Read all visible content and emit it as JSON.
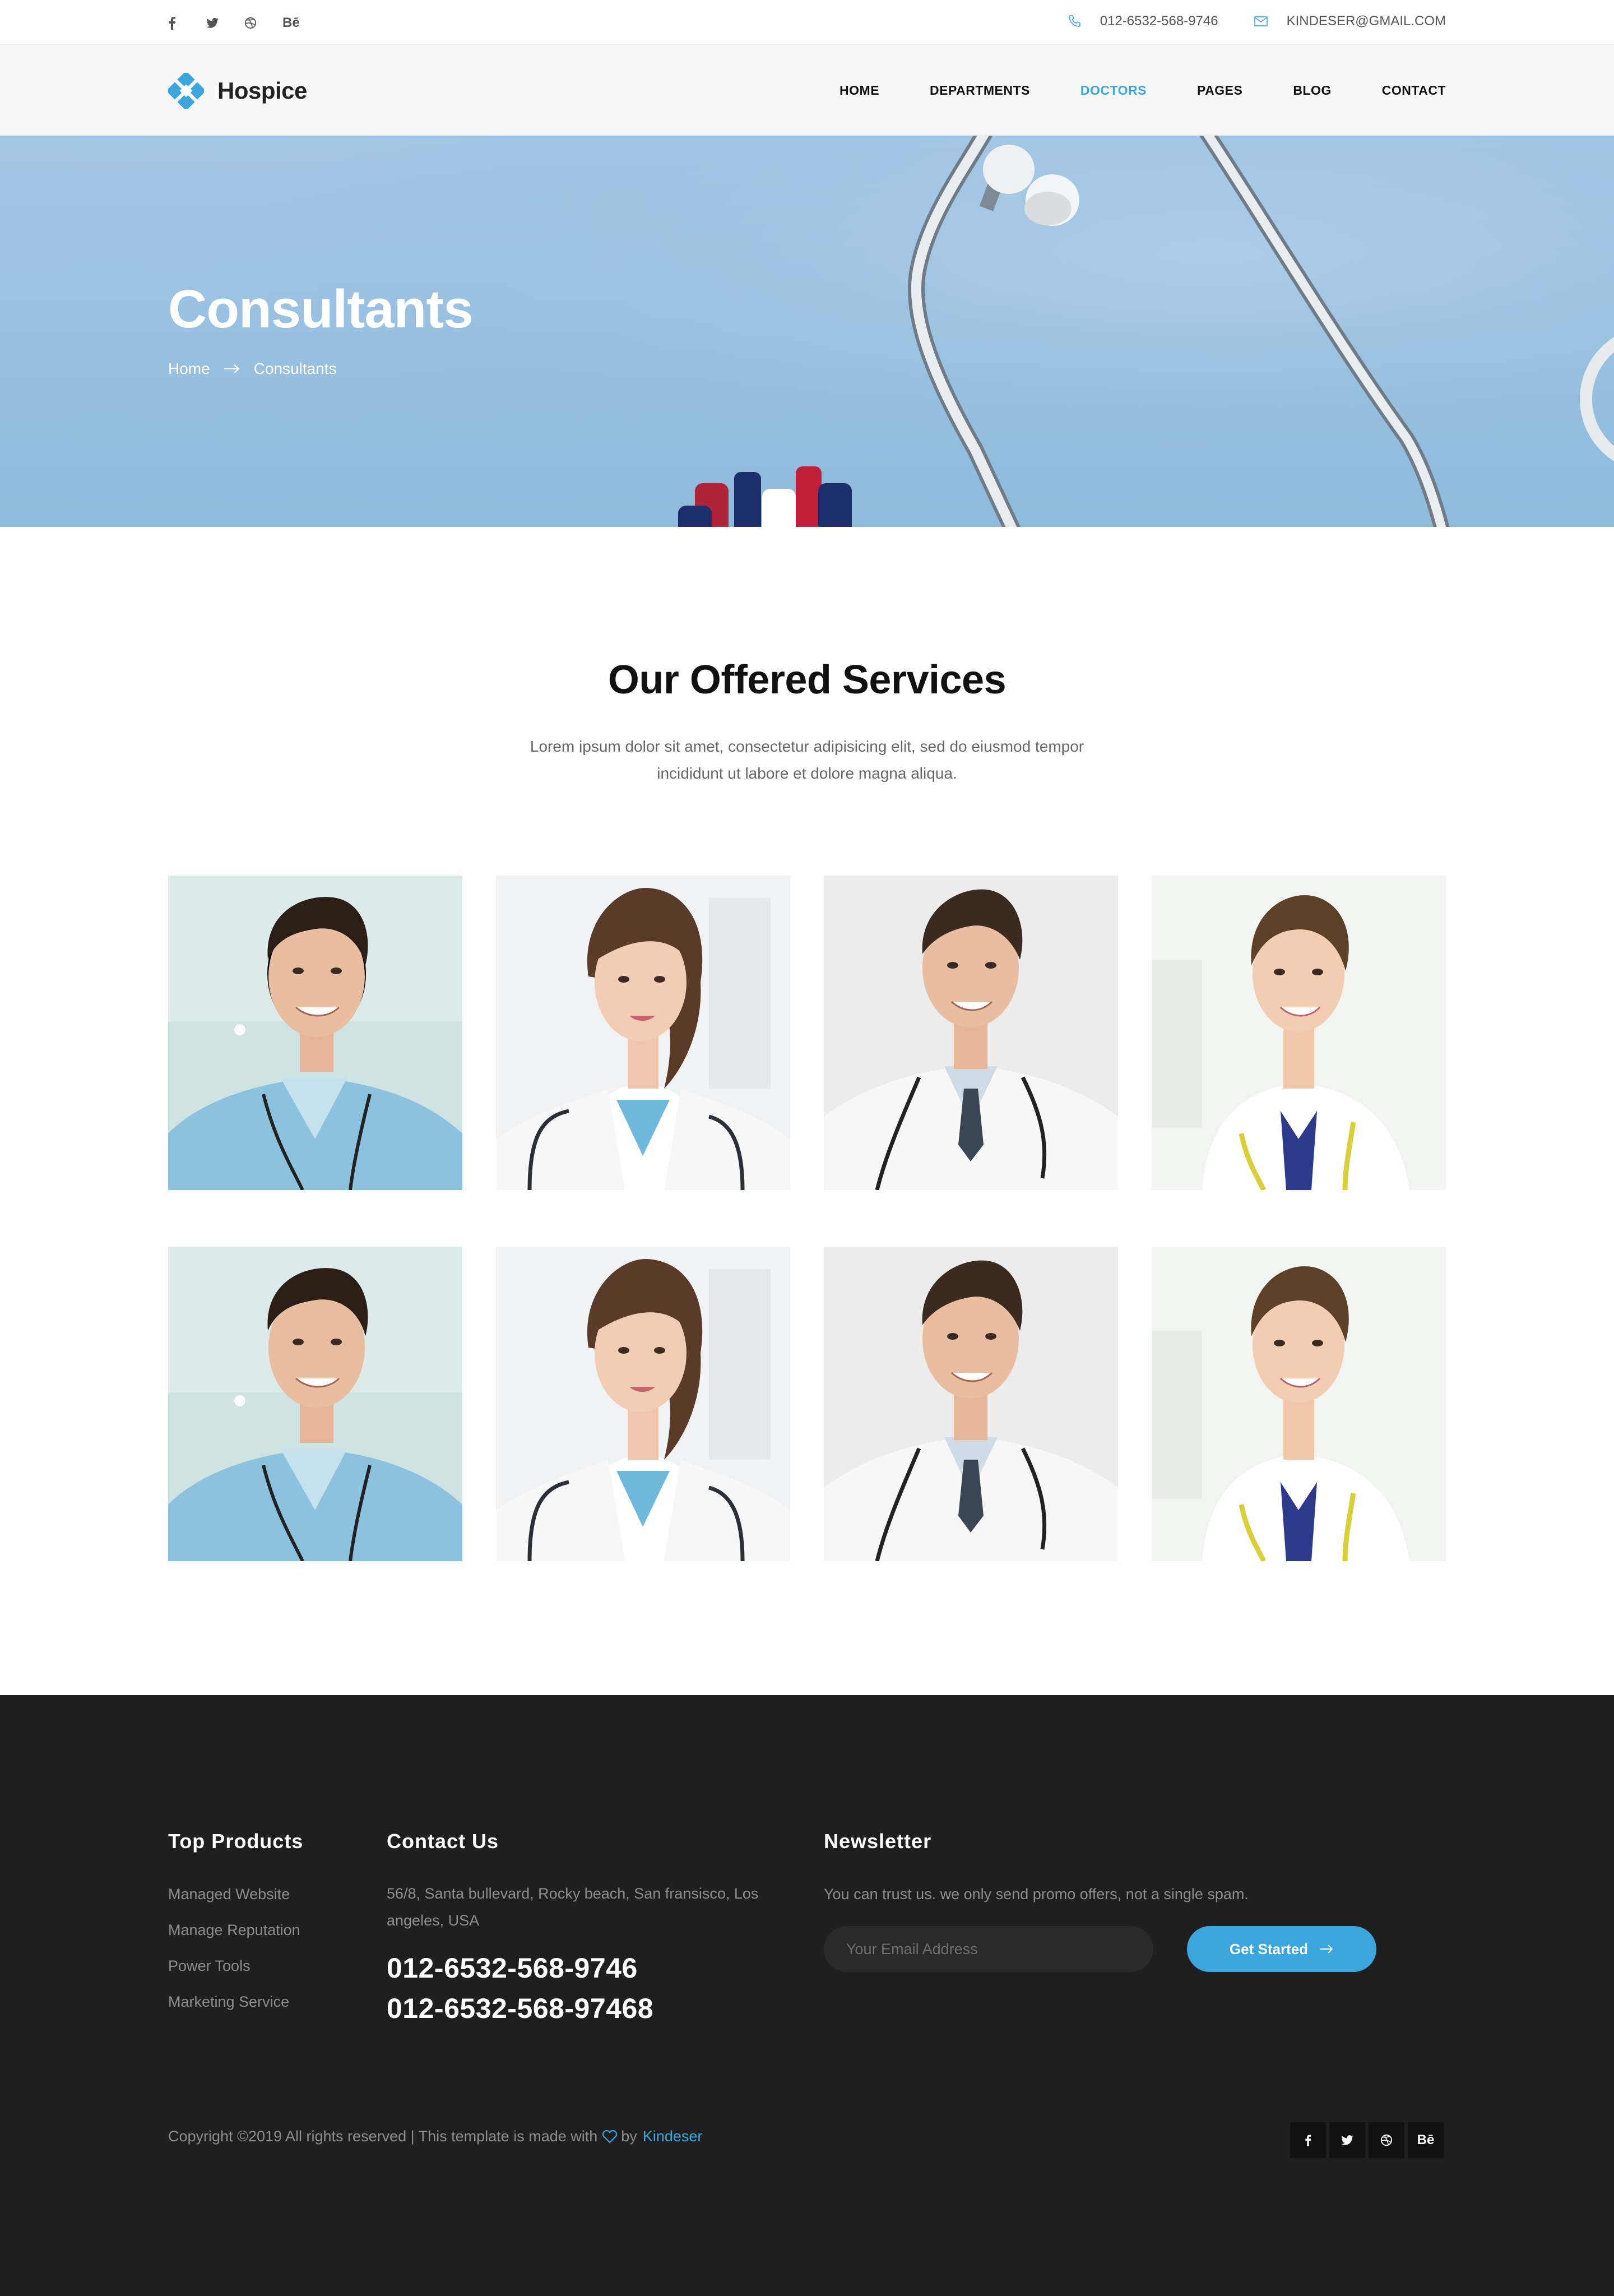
{
  "topbar": {
    "social_icons": [
      "facebook-icon",
      "twitter-icon",
      "dribbble-icon",
      "behance-icon"
    ],
    "behance_glyph": "Bē",
    "phone": "012-6532-568-9746",
    "email": "KINDESER@GMAIL.COM"
  },
  "header": {
    "logo_text": "Hospice",
    "nav": [
      {
        "label": "HOME",
        "active": false
      },
      {
        "label": "DEPARTMENTS",
        "active": false
      },
      {
        "label": "DOCTORS",
        "active": true
      },
      {
        "label": "PAGES",
        "active": false
      },
      {
        "label": "BLOG",
        "active": false
      },
      {
        "label": "CONTACT",
        "active": false
      }
    ]
  },
  "hero": {
    "title": "Consultants",
    "breadcrumb": [
      "Home",
      "Consultants"
    ]
  },
  "services": {
    "title": "Our Offered Services",
    "description": "Lorem ipsum dolor sit amet, consectetur adipisicing elit, sed do eiusmod tempor incididunt ut labore et dolore magna aliqua.",
    "consultants": [
      {
        "photo": "male-doctor-scrubs"
      },
      {
        "photo": "female-doctor-ponytail"
      },
      {
        "photo": "male-doctor-tie"
      },
      {
        "photo": "female-doctor-smiling"
      },
      {
        "photo": "male-doctor-scrubs"
      },
      {
        "photo": "female-doctor-ponytail"
      },
      {
        "photo": "male-doctor-tie"
      },
      {
        "photo": "female-doctor-smiling"
      }
    ]
  },
  "footer": {
    "top_products": {
      "title": "Top Products",
      "links": [
        "Managed Website",
        "Manage Reputation",
        "Power Tools",
        "Marketing Service"
      ]
    },
    "contact": {
      "title": "Contact Us",
      "address": "56/8, Santa bullevard, Rocky beach, San fransisco, Los angeles, USA",
      "phone_1": "012-6532-568-9746",
      "phone_2": "012-6532-568-97468"
    },
    "newsletter": {
      "title": "Newsletter",
      "text": "You can trust us. we only send promo offers, not a single spam.",
      "placeholder": "Your Email Address",
      "button_label": "Get Started"
    },
    "copyright": {
      "text": "Copyright ©2019 All rights reserved | This template is made with",
      "by": "by",
      "author": "Kindeser"
    },
    "social_icons": [
      "facebook-icon",
      "twitter-icon",
      "dribbble-icon",
      "behance-icon"
    ],
    "behance_glyph": "Bē"
  },
  "colors": {
    "accent": "#3ba5de",
    "footer_bg": "#1f1f1f",
    "hero_bg": "#9cc2e2"
  }
}
